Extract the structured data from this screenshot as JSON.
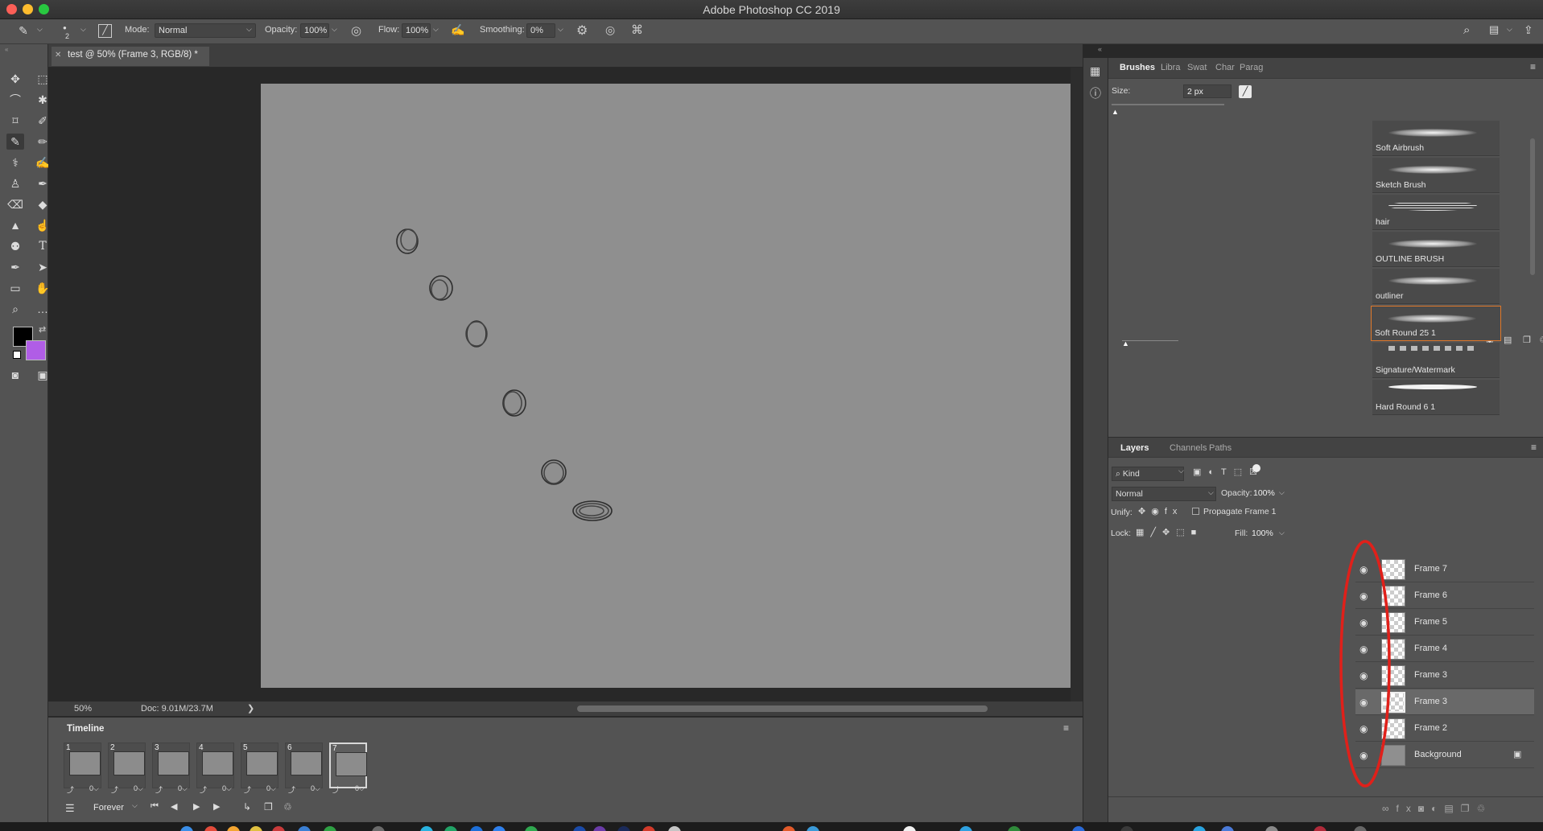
{
  "app": {
    "title": "Adobe Photoshop CC 2019"
  },
  "options": {
    "brush_size": "2",
    "mode_label": "Mode:",
    "mode_value": "Normal",
    "opacity_label": "Opacity:",
    "opacity_value": "100%",
    "flow_label": "Flow:",
    "flow_value": "100%",
    "smoothing_label": "Smoothing:",
    "smoothing_value": "0%"
  },
  "document": {
    "tab": "test @ 50% (Frame 3, RGB/8) *",
    "zoom": "50%",
    "doc_info": "Doc: 9.01M/23.7M"
  },
  "timeline": {
    "title": "Timeline",
    "loop": "Forever",
    "frames": [
      {
        "num": "1",
        "delay": "0"
      },
      {
        "num": "2",
        "delay": "0"
      },
      {
        "num": "3",
        "delay": "0"
      },
      {
        "num": "4",
        "delay": "0"
      },
      {
        "num": "5",
        "delay": "0"
      },
      {
        "num": "6",
        "delay": "0"
      },
      {
        "num": "7",
        "delay": "0"
      }
    ]
  },
  "brushes": {
    "tabs": [
      "Brushes",
      "Libra",
      "Swat",
      "Char",
      "Parag"
    ],
    "size_label": "Size:",
    "size_value": "2 px",
    "items": [
      "Soft Airbrush",
      "Sketch Brush",
      "hair",
      "OUTLINE BRUSH",
      "outliner",
      "Soft Round 25 1",
      "Signature/Watermark",
      "Hard Round 6 1"
    ],
    "selected": "Soft Round 25 1"
  },
  "layers": {
    "tabs": [
      "Layers",
      "Channels",
      "Paths"
    ],
    "kind": "Kind",
    "blend": "Normal",
    "opacity_label": "Opacity:",
    "opacity_value": "100%",
    "unify_label": "Unify:",
    "propagate_label": "Propagate Frame 1",
    "lock_label": "Lock:",
    "fill_label": "Fill:",
    "fill_value": "100%",
    "items": [
      "Frame 7",
      "Frame 6",
      "Frame 5",
      "Frame 4",
      "Frame 3",
      "Frame 3",
      "Frame 2",
      "Background"
    ],
    "selected": "Frame 3"
  },
  "colors": {
    "foreground": "#000000",
    "background": "#b05de6",
    "annotation": "#e0201a"
  }
}
